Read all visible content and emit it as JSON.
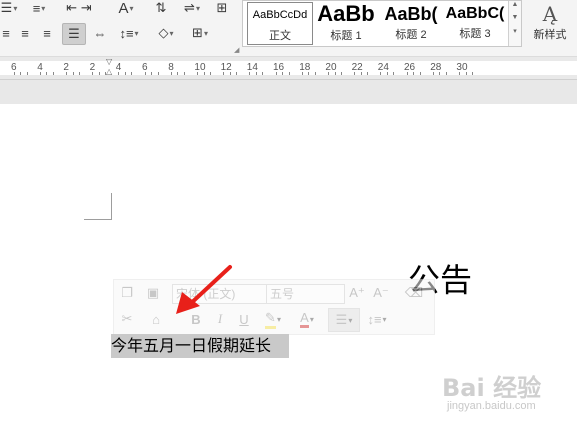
{
  "ribbon": {
    "para": {
      "row1": [
        "bullet-list-icon",
        "decrease-indent-icon",
        "font-size-shrink-icon",
        "sort-icon",
        "line-spacing-adjust-icon",
        "table-icon"
      ],
      "row2": [
        "align-left-icon",
        "align-center-icon",
        "align-right-icon",
        "justify-icon",
        "distributed-icon",
        "line-spacing-icon",
        "shading-icon",
        "borders-icon"
      ]
    },
    "styles": {
      "items": [
        {
          "sample": "AaBbCcDd",
          "label": "正文"
        },
        {
          "sample": "AaBb",
          "label": "标题 1"
        },
        {
          "sample": "AaBb(",
          "label": "标题 2"
        },
        {
          "sample": "AaBbC(",
          "label": "标题 3"
        }
      ],
      "new_style_label": "新样式"
    }
  },
  "ruler": {
    "numbers": [
      "6",
      "4",
      "2",
      "2",
      "4",
      "6",
      "8",
      "10",
      "12",
      "14",
      "16",
      "18",
      "20",
      "22",
      "24",
      "26",
      "28",
      "30"
    ]
  },
  "document": {
    "title": "公告",
    "line1": "今年五月一日假期延长"
  },
  "mini_toolbar": {
    "font_name": "宋体 (正文)",
    "font_size": "五号",
    "grow_font": "A⁺",
    "shrink_font": "A⁻",
    "bold": "B",
    "italic": "I",
    "underline": "U",
    "font_color": "A"
  },
  "annotation": {
    "arrow_color": "#e8201a"
  },
  "watermark": {
    "logo": "Bai 经验",
    "url": "jingyan.baidu.com"
  }
}
